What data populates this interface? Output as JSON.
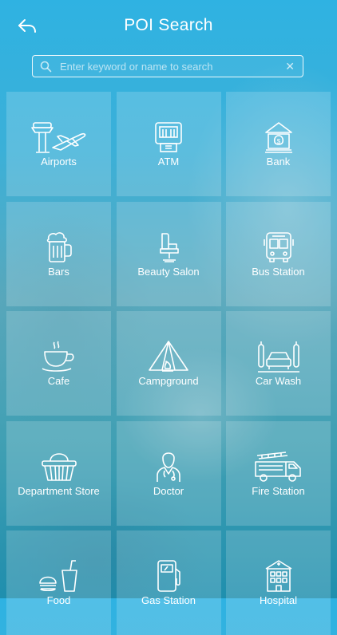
{
  "header": {
    "title": "POI Search",
    "back_icon": "back-arrow-icon"
  },
  "search": {
    "placeholder": "Enter keyword or name to search",
    "value": "",
    "clear_glyph": "✕"
  },
  "categories": [
    {
      "label": "Airports",
      "icon": "airport-icon"
    },
    {
      "label": "ATM",
      "icon": "atm-icon"
    },
    {
      "label": "Bank",
      "icon": "bank-icon"
    },
    {
      "label": "Bars",
      "icon": "beer-mug-icon"
    },
    {
      "label": "Beauty Salon",
      "icon": "salon-chair-icon"
    },
    {
      "label": "Bus Station",
      "icon": "bus-icon"
    },
    {
      "label": "Cafe",
      "icon": "coffee-cup-icon"
    },
    {
      "label": "Campground",
      "icon": "tent-icon"
    },
    {
      "label": "Car Wash",
      "icon": "car-wash-icon"
    },
    {
      "label": "Department Store",
      "icon": "basket-icon"
    },
    {
      "label": "Doctor",
      "icon": "doctor-icon"
    },
    {
      "label": "Fire Station",
      "icon": "fire-truck-icon"
    },
    {
      "label": "Food",
      "icon": "food-icon"
    },
    {
      "label": "Gas Station",
      "icon": "gas-pump-icon"
    },
    {
      "label": "Hospital",
      "icon": "hospital-icon"
    }
  ]
}
